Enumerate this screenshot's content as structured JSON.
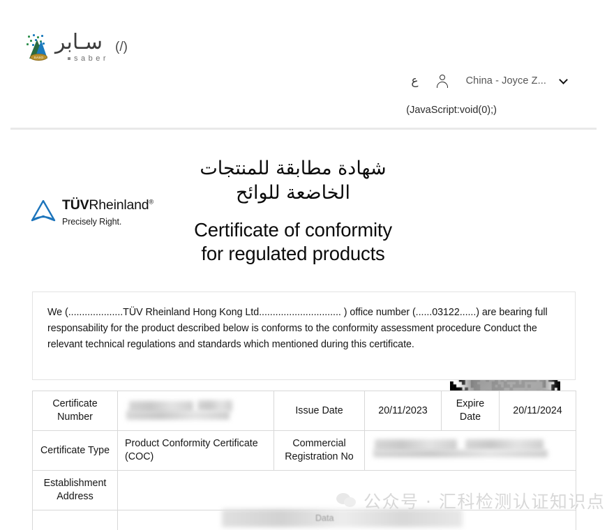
{
  "header": {
    "brand": {
      "arabic": "سـابر",
      "latin": "saber",
      "badge": "SASO",
      "link_slash": "(/)"
    },
    "arabic_lang_glyph": "ع",
    "account_name": "China - Joyce Z...",
    "js_link": "(JavaScript:void(0);)"
  },
  "certificate": {
    "logo": {
      "name_bold": "TÜV",
      "name_rest": "Rheinland",
      "registered": "®",
      "tagline": "Precisely Right."
    },
    "title_ar_line1": "شهادة مطابقة للمنتجات",
    "title_ar_line2": "الخاضعة للوائح",
    "title_en_line1": "Certificate of conformity",
    "title_en_line2": "for regulated products",
    "declaration": "We (....................TÜV Rheinland Hong Kong Ltd.............................. ) office number (......03122......) are bearing full responsability for the product described below is conforms to the conformity assessment procedure Conduct the relevant technical regulations and standards which mentioned during this certificate.",
    "table": {
      "row1": {
        "label1": "Certificate Number",
        "value1": "",
        "label2": "Issue Date",
        "value2": "20/11/2023",
        "label3": "Expire Date",
        "value3": "20/11/2024"
      },
      "row2": {
        "label1": "Certificate Type",
        "value1": "Product Conformity Certificate (COC)",
        "label2": "Commercial Registration No",
        "value2": ""
      },
      "row3": {
        "label1": "Establishment Address",
        "value1": ""
      },
      "row4": {
        "value1": "Data"
      }
    }
  },
  "watermark": {
    "text": "公众号 · 汇科检测认证知识点"
  },
  "colors": {
    "tuv_blue": "#1c74bb",
    "divider": "#e9e9e9",
    "table_border": "#d8d8d8"
  }
}
